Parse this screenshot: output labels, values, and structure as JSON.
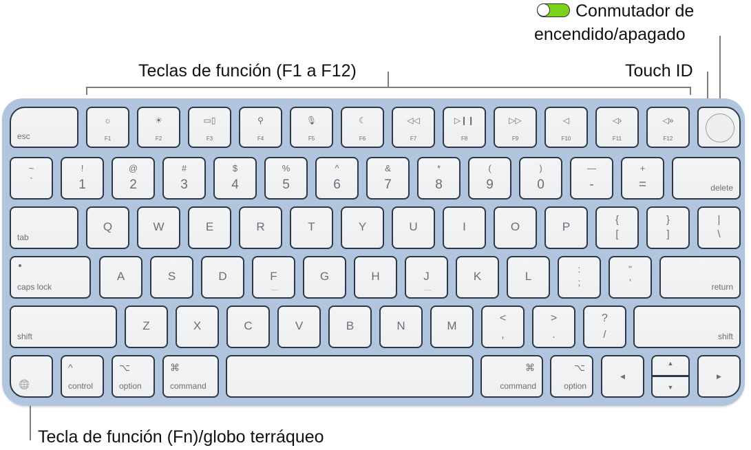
{
  "callouts": {
    "function_keys": "Teclas de función (F1 a F12)",
    "power_switch_line1": "Conmutador de",
    "power_switch_line2": "encendido/apagado",
    "touch_id": "Touch ID",
    "fn_globe": "Tecla de función (Fn)/globo terráqueo"
  },
  "colors": {
    "keyboard_body": "#b2c5df",
    "key_face": "#f0f1f3",
    "key_border": "#2d3645",
    "toggle_on": "#7bd21b"
  },
  "keys": {
    "esc": "esc",
    "function_row": [
      {
        "label": "F1",
        "icon": "☼"
      },
      {
        "label": "F2",
        "icon": "☀"
      },
      {
        "label": "F3",
        "icon": "▭▯"
      },
      {
        "label": "F4",
        "icon": "⚲"
      },
      {
        "label": "F5",
        "icon": "🎙"
      },
      {
        "label": "F6",
        "icon": "☾"
      },
      {
        "label": "F7",
        "icon": "◁◁"
      },
      {
        "label": "F8",
        "icon": "▷❙❙"
      },
      {
        "label": "F9",
        "icon": "▷▷"
      },
      {
        "label": "F10",
        "icon": "◁"
      },
      {
        "label": "F11",
        "icon": "◁›"
      },
      {
        "label": "F12",
        "icon": "◁»"
      }
    ],
    "number_row": [
      {
        "top": "~",
        "bottom": "`"
      },
      {
        "top": "!",
        "bottom": "1"
      },
      {
        "top": "@",
        "bottom": "2"
      },
      {
        "top": "#",
        "bottom": "3"
      },
      {
        "top": "$",
        "bottom": "4"
      },
      {
        "top": "%",
        "bottom": "5"
      },
      {
        "top": "^",
        "bottom": "6"
      },
      {
        "top": "&",
        "bottom": "7"
      },
      {
        "top": "*",
        "bottom": "8"
      },
      {
        "top": "(",
        "bottom": "9"
      },
      {
        "top": ")",
        "bottom": "0"
      },
      {
        "top": "—",
        "bottom": "-"
      },
      {
        "top": "+",
        "bottom": "="
      }
    ],
    "delete": "delete",
    "tab": "tab",
    "qwerty_row": [
      "Q",
      "W",
      "E",
      "R",
      "T",
      "Y",
      "U",
      "I",
      "O",
      "P"
    ],
    "bracket_left": {
      "top": "{",
      "bottom": "["
    },
    "bracket_right": {
      "top": "}",
      "bottom": "]"
    },
    "backslash": {
      "top": "|",
      "bottom": "\\"
    },
    "caps_lock": "caps lock",
    "home_row": [
      "A",
      "S",
      "D",
      "F",
      "G",
      "H",
      "J",
      "K",
      "L"
    ],
    "semicolon": {
      "top": ":",
      "bottom": ";"
    },
    "quote": {
      "top": "\"",
      "bottom": "'"
    },
    "return": "return",
    "shift": "shift",
    "bottom_letters": [
      "Z",
      "X",
      "C",
      "V",
      "B",
      "N",
      "M"
    ],
    "comma": {
      "top": "<",
      "bottom": ","
    },
    "period": {
      "top": ">",
      "bottom": "."
    },
    "slash": {
      "top": "?",
      "bottom": "/"
    },
    "fn_globe_icon": "🌐",
    "control": {
      "symbol": "^",
      "label": "control"
    },
    "option": {
      "symbol": "⌥",
      "label": "option"
    },
    "command": {
      "symbol": "⌘",
      "label": "command"
    },
    "arrows": {
      "left": "◀",
      "up": "▲",
      "down": "▼",
      "right": "▶"
    }
  }
}
